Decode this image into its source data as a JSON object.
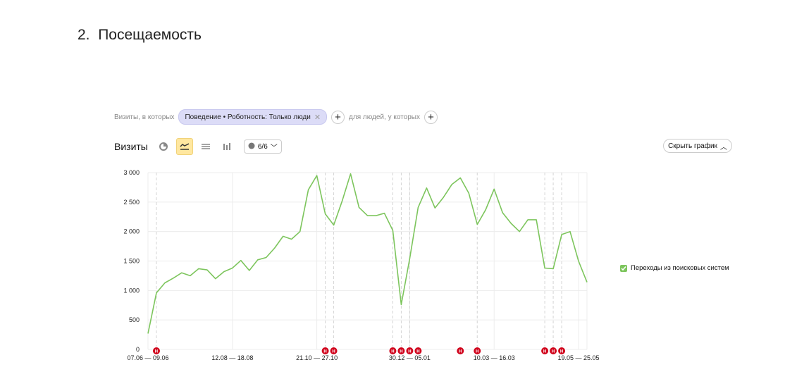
{
  "section": {
    "number": "2.",
    "title": "Посещаемость"
  },
  "filters": {
    "prefix": "Визиты, в которых",
    "chip_label": "Поведение • Роботность: Только люди",
    "suffix": "для людей, у которых"
  },
  "toolbar": {
    "title": "Визиты",
    "icons": [
      "pie-chart-icon",
      "line-chart-icon",
      "area-chart-icon",
      "bar-chart-icon"
    ],
    "active_icon": "line-chart-icon",
    "annotations_label": "6/6",
    "hide_chart_label": "Скрыть график"
  },
  "colors": {
    "series": "#7dc55d",
    "marker": "#d0021b",
    "active": "#ffe7a0"
  },
  "chart_data": {
    "type": "line",
    "title": "",
    "xlabel": "",
    "ylabel": "",
    "ylim": [
      0,
      3000
    ],
    "yticks": [
      0,
      500,
      1000,
      1500,
      2000,
      2500,
      3000
    ],
    "ytick_labels": [
      "0",
      "500",
      "1 000",
      "1 500",
      "2 000",
      "2 500",
      "3 000"
    ],
    "xtick_labels": [
      "07.06 — 09.06",
      "12.08 — 18.08",
      "21.10 — 27.10",
      "30.12 — 05.01",
      "10.03 — 16.03",
      "19.05 — 25.05"
    ],
    "xtick_index": [
      0,
      10,
      20,
      31,
      41,
      51
    ],
    "grid": true,
    "legend_position": "right",
    "series": [
      {
        "name": "Переходы из поисковых систем",
        "values": [
          270,
          960,
          1130,
          1210,
          1300,
          1250,
          1370,
          1350,
          1200,
          1320,
          1380,
          1510,
          1340,
          1520,
          1560,
          1720,
          1920,
          1870,
          2000,
          2710,
          2950,
          2300,
          2110,
          2520,
          2980,
          2410,
          2270,
          2270,
          2310,
          2020,
          760,
          1540,
          2410,
          2740,
          2400,
          2580,
          2800,
          2910,
          2650,
          2120,
          2370,
          2720,
          2320,
          2140,
          2000,
          2200,
          2200,
          1380,
          1370,
          1950,
          2000,
          1500,
          1140
        ]
      }
    ],
    "annotation_marker_label": "Н",
    "annotation_indices": [
      1,
      21,
      22,
      29,
      30,
      31,
      32,
      37,
      39,
      47,
      48,
      49
    ],
    "dashed_line_indices": [
      1,
      21,
      22,
      29,
      30,
      31,
      39,
      47,
      48,
      49
    ]
  }
}
